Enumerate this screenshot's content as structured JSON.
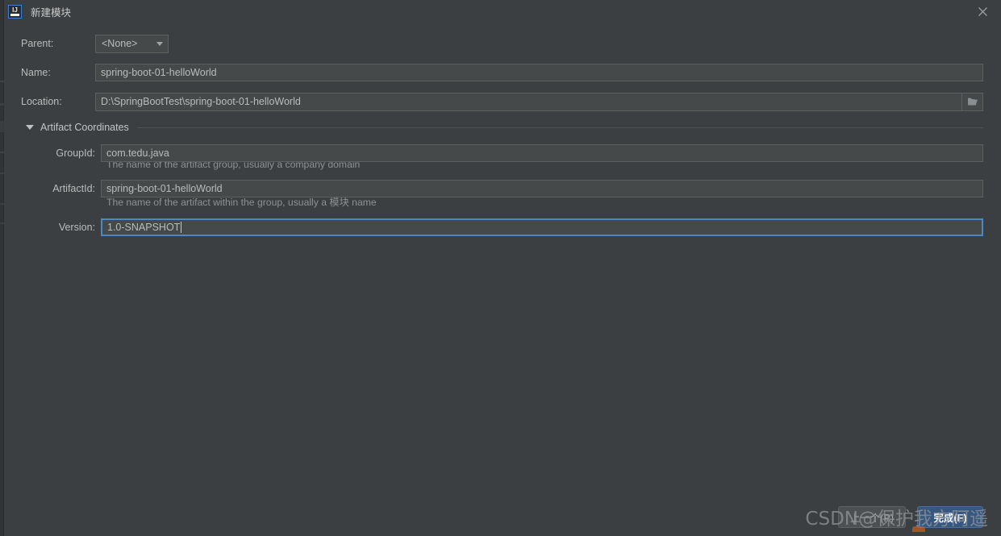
{
  "window": {
    "title": "新建模块",
    "app_icon": "intellij-idea-icon",
    "close_icon": "close-icon"
  },
  "form": {
    "parent": {
      "label": "Parent:",
      "value": "<None>",
      "dropdown_icon": "chevron-down-icon"
    },
    "name": {
      "label": "Name:",
      "value": "spring-boot-01-helloWorld"
    },
    "location": {
      "label": "Location:",
      "value": "D:\\SpringBootTest\\spring-boot-01-helloWorld",
      "browse_icon": "folder-icon"
    },
    "section": {
      "label": "Artifact Coordinates",
      "expanded_icon": "triangle-down-icon"
    },
    "group_id": {
      "label": "GroupId:",
      "value": "com.tedu.java",
      "helper": "The name of the artifact group, usually a company domain"
    },
    "artifact_id": {
      "label": "ArtifactId:",
      "value": "spring-boot-01-helloWorld",
      "helper": "The name of the artifact within the group, usually a 模块 name"
    },
    "version": {
      "label": "Version:",
      "value": "1.0-SNAPSHOT",
      "focused": true
    }
  },
  "footer": {
    "previous_label": "上一个(P)",
    "finish_label": "完成(F)"
  },
  "watermark": {
    "text": "CSDN",
    "suffix": "@保护我方阿遥"
  },
  "colors": {
    "dialog_background": "#3c3f41",
    "field_background": "#45494a",
    "field_border": "#5e6060",
    "focus_border": "#4a88c7",
    "primary_button": "#365880",
    "text": "#bbbbbb",
    "helper_text": "#8d9194"
  }
}
